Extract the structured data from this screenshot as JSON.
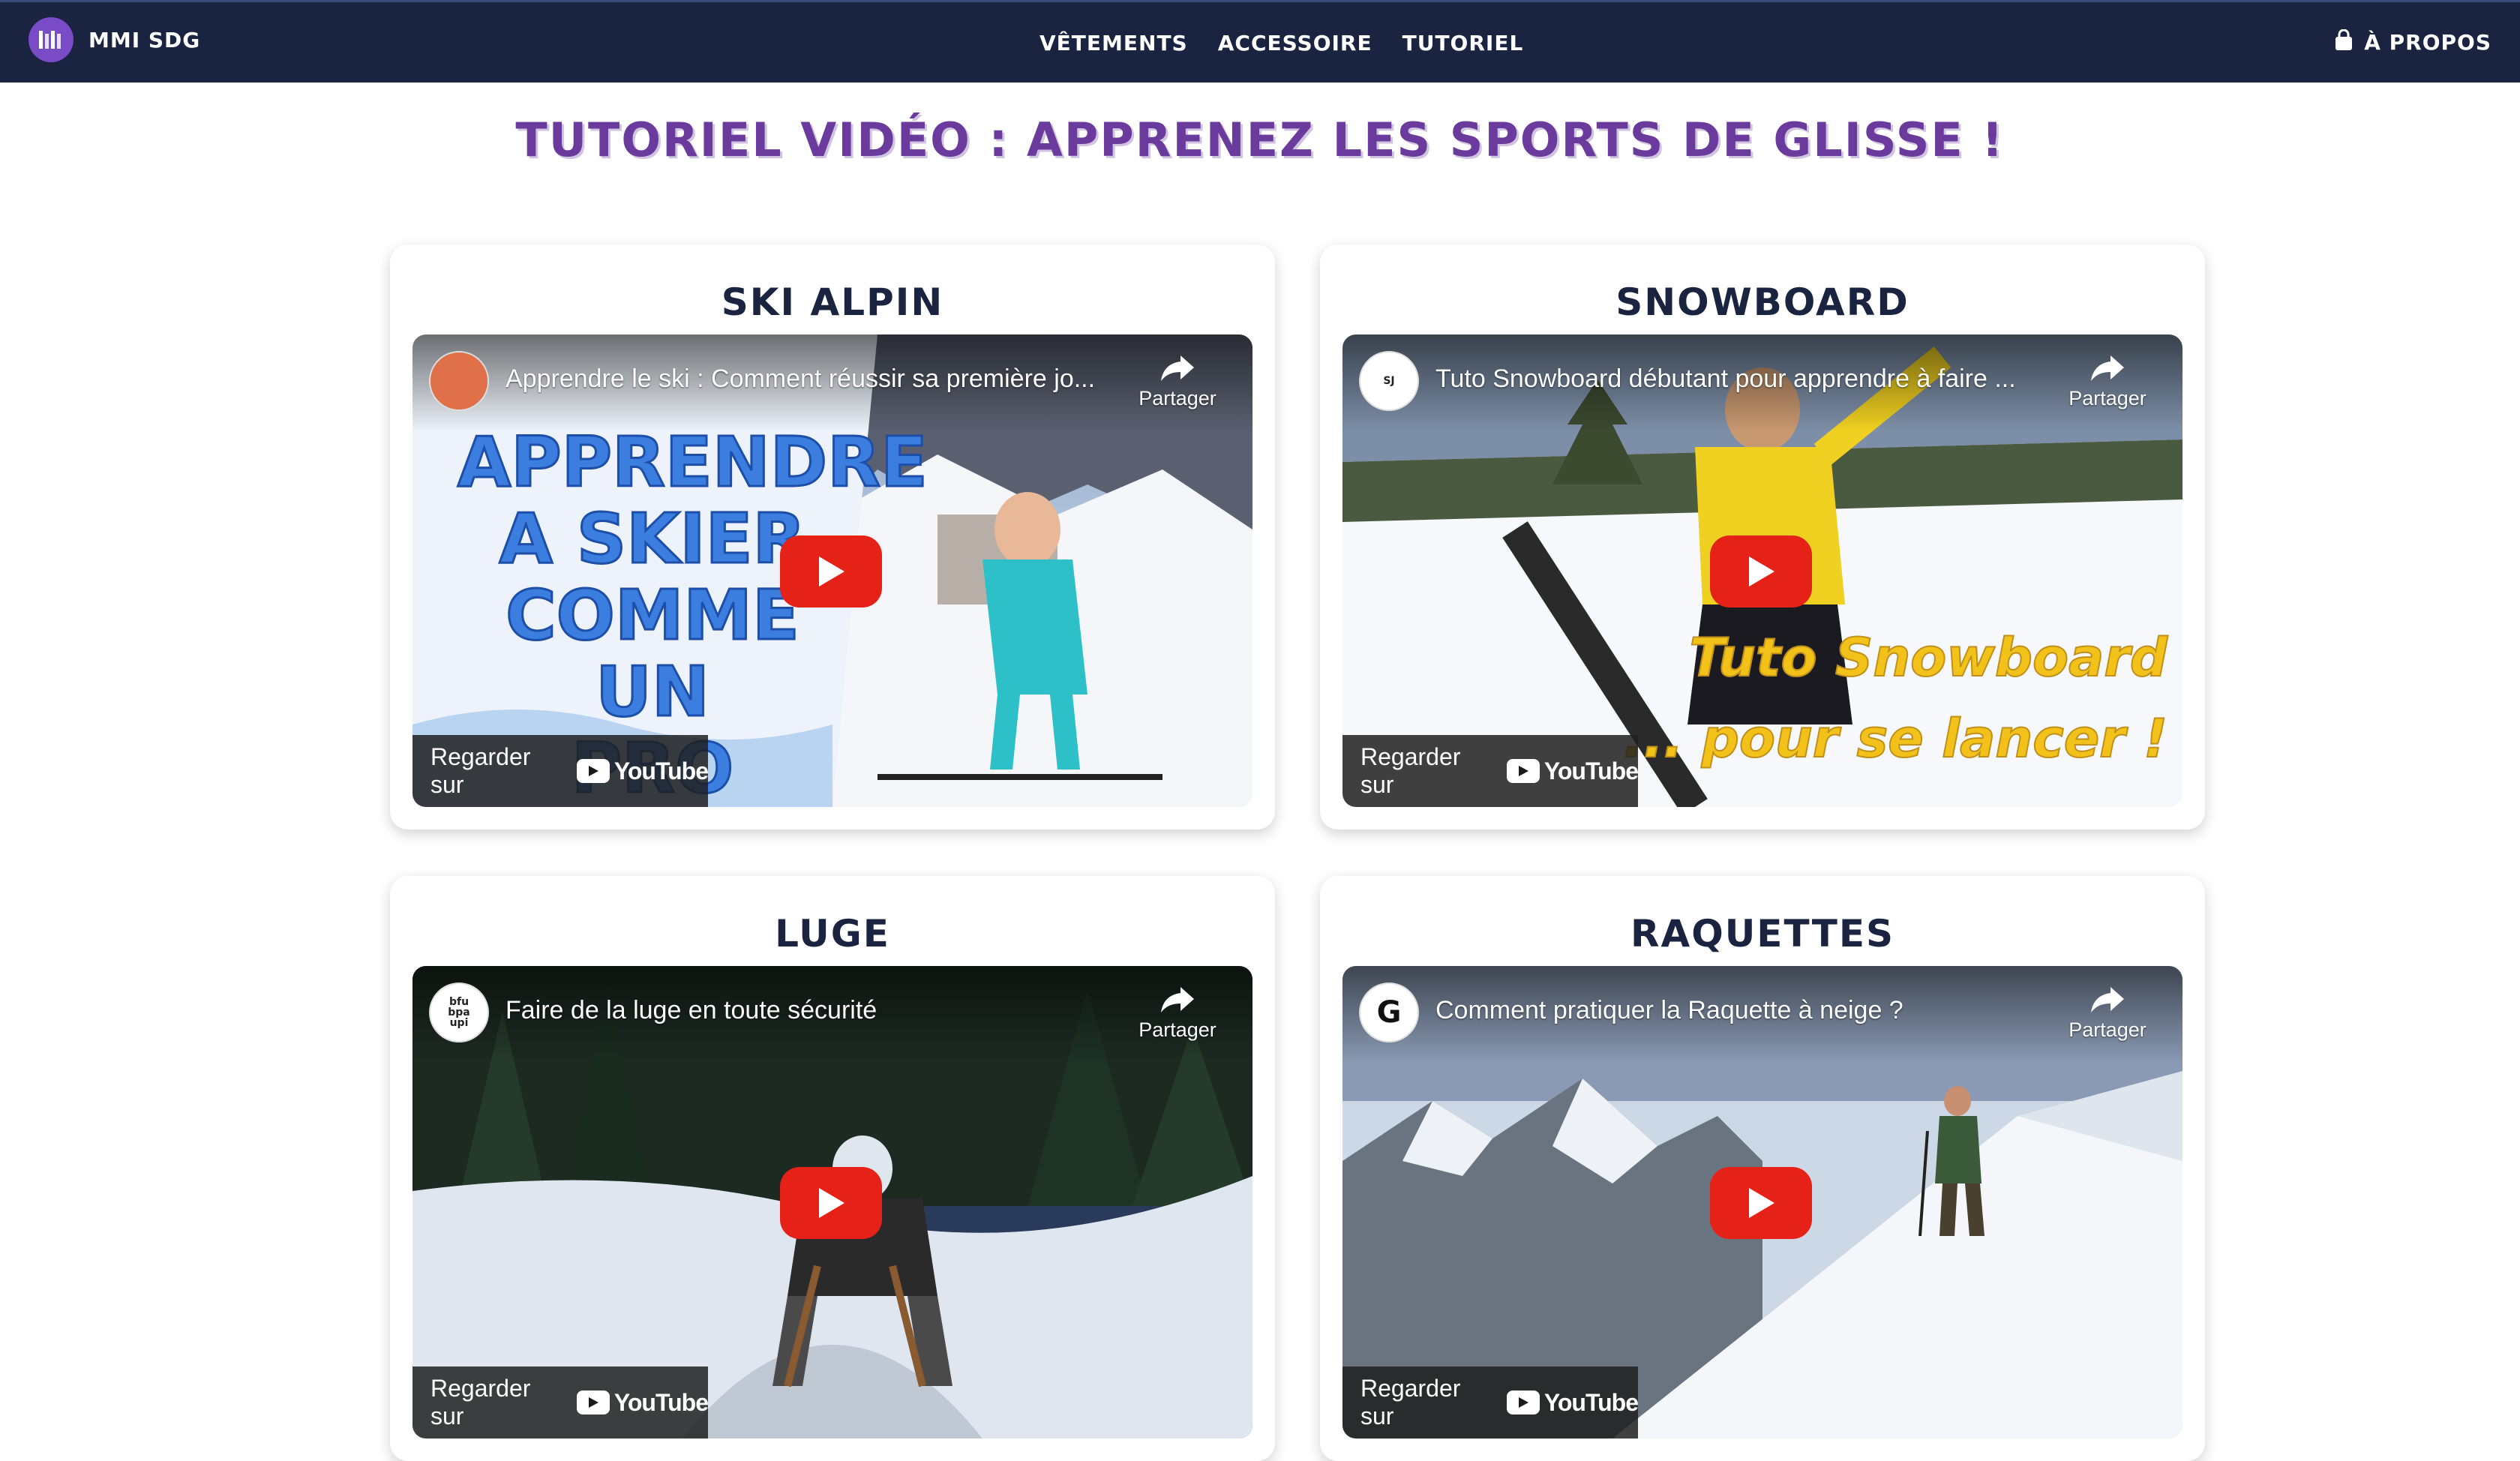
{
  "nav": {
    "brand": "MMI SDG",
    "links": [
      "VÊTEMENTS",
      "ACCESSOIRE",
      "TUTORIEL"
    ],
    "right_label": "À PROPOS"
  },
  "page_title": "TUTORIEL VIDÉO : APPRENEZ LES SPORTS DE GLISSE !",
  "share_label": "Partager",
  "watch_label": "Regarder sur",
  "youtube_label": "YouTube",
  "cards": [
    {
      "title": "SKI ALPIN",
      "video_title": "Apprendre le ski : Comment réussir sa première jo...",
      "thumb_text": [
        "APPRENDRE",
        "A SKIER",
        "COMME UN",
        "PRO"
      ]
    },
    {
      "title": "SNOWBOARD",
      "video_title": "Tuto Snowboard débutant pour apprendre à faire ...",
      "thumb_text": [
        "Tuto Snowboard",
        "... pour se lancer !"
      ]
    },
    {
      "title": "LUGE",
      "video_title": "Faire de la luge en toute sécurité",
      "channel_initials": "bfu bpa upi"
    },
    {
      "title": "RAQUETTES",
      "video_title": "Comment pratiquer la Raquette à neige ?"
    }
  ]
}
